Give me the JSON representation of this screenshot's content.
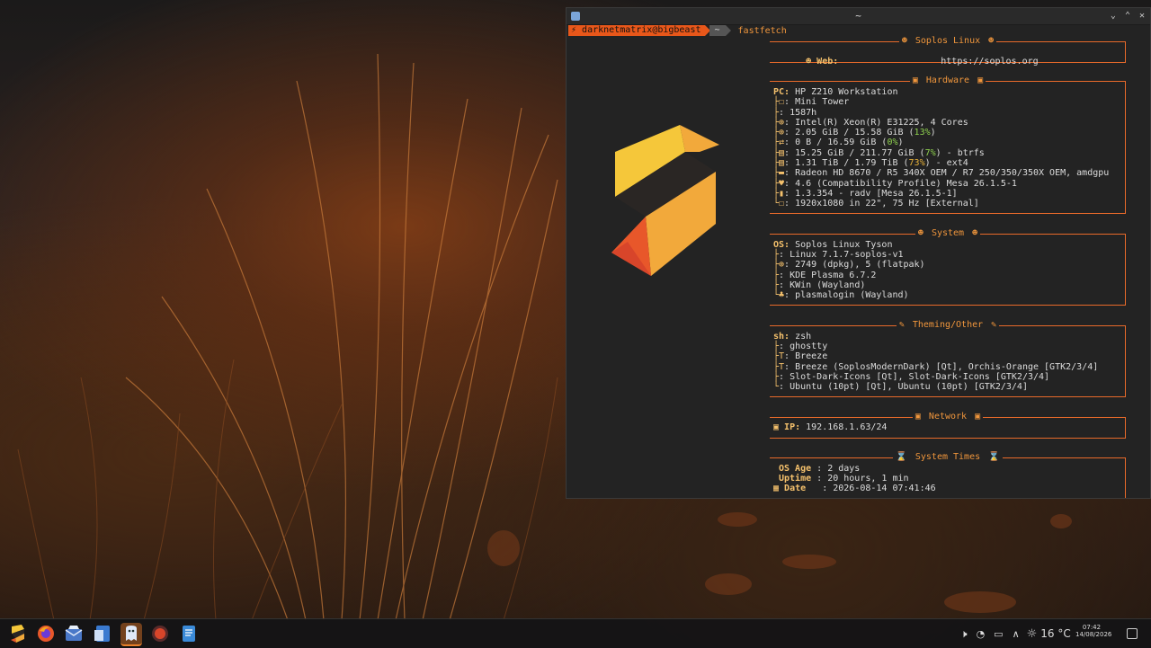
{
  "terminal": {
    "title": "~",
    "prompt_user": "darknetmatrix@bigbeast",
    "prompt_dir": "~",
    "command": "fastfetch"
  },
  "sections": {
    "soplos": {
      "header": "Soplos Linux",
      "web_key": "Web:",
      "web_value": "https://soplos.org"
    },
    "hardware": {
      "header": "Hardware",
      "pc_key": "PC:",
      "pc_value": "HP Z210 Workstation",
      "lines": [
        ": Mini Tower",
        ": 1587h",
        ": Intel(R) Xeon(R) E31225, 4 Cores",
        ": 2.05 GiB / 15.58 GiB (",
        ": 0 B / 16.59 GiB (",
        ": 15.25 GiB / 211.77 GiB (",
        ": 1.31 TiB / 1.79 TiB (",
        ": Radeon HD 8670 / R5 340X OEM / R7 250/350/350X OEM, amdgpu",
        ": 4.6 (Compatibility Profile) Mesa 26.1.5-1",
        ": 1.3.354 - radv [Mesa 26.1.5-1]",
        ": 1920x1080 in 22\", 75 Hz [External]"
      ],
      "mem_pct": "13%",
      "swap_pct": "0%",
      "disk1_pct": "7%",
      "disk2_pct": "73%",
      "disk1_fs": ") - btrfs",
      "disk2_fs": ") - ext4",
      "close_paren": ")"
    },
    "system": {
      "header": "System",
      "os_key": "OS:",
      "os_value": "Soplos Linux Tyson",
      "lines": [
        ": Linux 7.1.7-soplos-v1",
        ": 2749 (dpkg), 5 (flatpak)",
        ": KDE Plasma 6.7.2",
        ": KWin (Wayland)",
        ": plasmalogin (Wayland)"
      ]
    },
    "theming": {
      "header": "Theming/Other",
      "sh_key": "sh:",
      "sh_value": "zsh",
      "lines": [
        ": ghostty",
        ": Breeze",
        ": Breeze (SoplosModernDark) [Qt], Orchis-Orange [GTK2/3/4]",
        ": Slot-Dark-Icons [Qt], Slot-Dark-Icons [GTK2/3/4]",
        ": Ubuntu (10pt) [Qt], Ubuntu (10pt) [GTK2/3/4]"
      ]
    },
    "network": {
      "header": "Network",
      "ip_key": "IP:",
      "ip_value": "192.168.1.63/24"
    },
    "times": {
      "header": "System Times",
      "age_key": "OS Age",
      "age_value": ": 2 days",
      "uptime_key": "Uptime",
      "uptime_value": ": 20 hours, 1 min",
      "date_key": "Date",
      "date_value": ": 2026-08-14 07:41:46"
    }
  },
  "taskbar": {
    "apps": [
      "soplos-menu",
      "firefox",
      "mail",
      "file-manager",
      "ghostty-terminal",
      "audio-player",
      "text-editor"
    ],
    "weather": "16 °C",
    "time": "07:42",
    "date": "14/08/2026"
  },
  "colors": {
    "accent": "#e86a2a",
    "key": "#f5c16c",
    "ok": "#8fd14f",
    "warn": "#e8b23a"
  }
}
